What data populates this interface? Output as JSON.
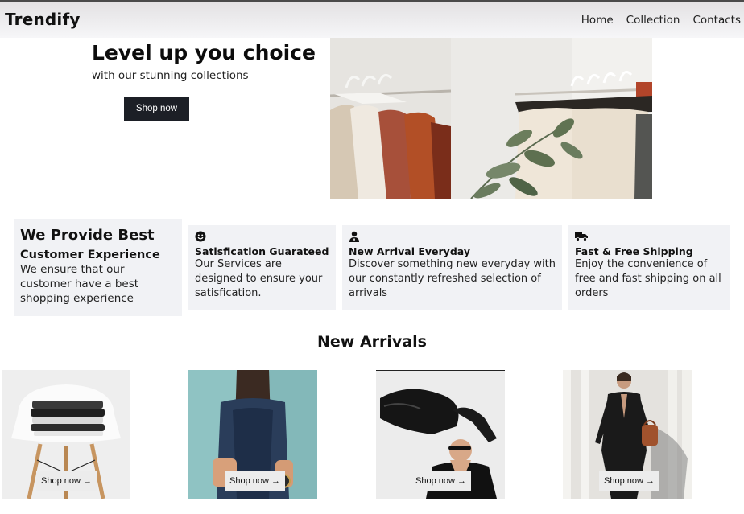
{
  "brand": "Trendify",
  "nav": {
    "home": "Home",
    "collection": "Collection",
    "contacts": "Contacts"
  },
  "hero": {
    "title": "Level up you choice",
    "subtitle": "with our stunning collections",
    "button": "Shop now"
  },
  "intro": {
    "heading": "We Provide Best",
    "subheading": "Customer Experience",
    "text": "We ensure that our customer have a best shopping experience"
  },
  "features": [
    {
      "icon": "smiley-icon",
      "title": "Satisfication Guarateed",
      "text": "Our Services are designed to ensure your satisfication."
    },
    {
      "icon": "user-icon",
      "title": "New Arrival Everyday",
      "text": "Discover something new everyday with our constantly refreshed selection of arrivals"
    },
    {
      "icon": "truck-icon",
      "title": "Fast & Free Shipping",
      "text": "Enjoy the convenience of free and fast shipping on all orders"
    }
  ],
  "arrivals": {
    "title": "New Arrivals",
    "items": [
      {
        "label": "Shop now",
        "arrow": "→"
      },
      {
        "label": "Shop now",
        "arrow": "→"
      },
      {
        "label": "Shop now",
        "arrow": "→"
      },
      {
        "label": "Shop now",
        "arrow": "→"
      }
    ]
  }
}
